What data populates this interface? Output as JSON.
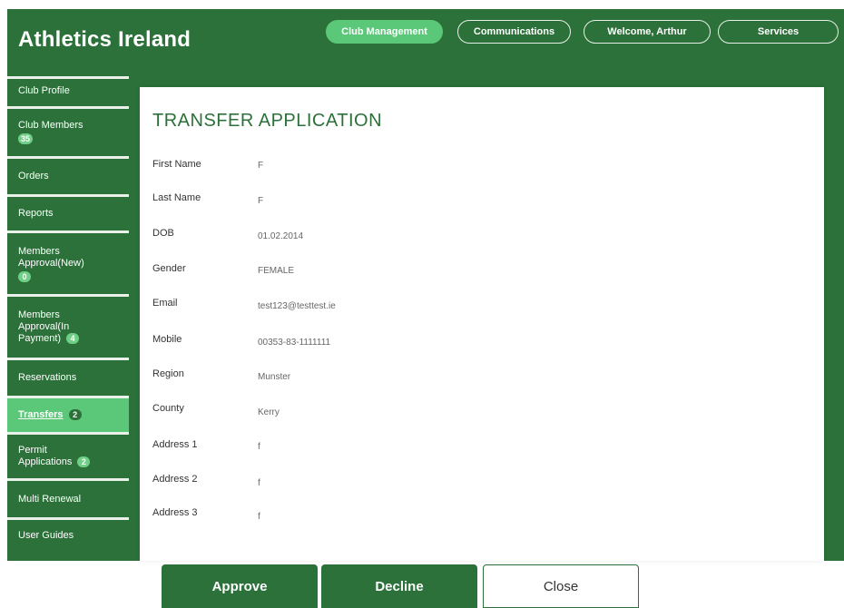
{
  "header": {
    "brand": "Athletics Ireland",
    "nav": [
      {
        "label": "Club Management",
        "active": true
      },
      {
        "label": "Communications",
        "active": false
      },
      {
        "label": "Welcome, Arthur",
        "active": false
      },
      {
        "label": "Services",
        "active": false
      }
    ]
  },
  "sidebar": {
    "items": [
      {
        "label": "Club Profile"
      },
      {
        "label": "Club Members",
        "badge": "35"
      },
      {
        "label": "Orders"
      },
      {
        "label": "Reports"
      },
      {
        "label_lines": [
          "Members",
          "Approval(New)"
        ],
        "badge": "0"
      },
      {
        "label_lines": [
          "Members",
          "Approval(In",
          "Payment)"
        ],
        "badge": "4"
      },
      {
        "label": "Reservations"
      },
      {
        "label": "Transfers",
        "badge": "2",
        "active": true
      },
      {
        "label_lines": [
          "Permit",
          "Applications"
        ],
        "badge": "2"
      },
      {
        "label": "Multi Renewal"
      },
      {
        "label": "User Guides"
      }
    ]
  },
  "form": {
    "title": "TRANSFER APPLICATION",
    "fields": [
      {
        "label": "First Name",
        "value": "F"
      },
      {
        "label": "Last Name",
        "value": "F"
      },
      {
        "label": "DOB",
        "value": "01.02.2014"
      },
      {
        "label": "Gender",
        "value": "FEMALE"
      },
      {
        "label": "Email",
        "value": "test123@testtest.ie"
      },
      {
        "label": "Mobile",
        "value": "00353-83-1111111"
      },
      {
        "label": "Region",
        "value": "Munster"
      },
      {
        "label": "County",
        "value": "Kerry"
      },
      {
        "label": "Address 1",
        "value": "f"
      },
      {
        "label": "Address 2",
        "value": "f"
      },
      {
        "label": "Address 3",
        "value": "f"
      }
    ]
  },
  "actions": {
    "approve": "Approve",
    "decline": "Decline",
    "close": "Close"
  },
  "colors": {
    "brand_green": "#2b7139",
    "accent_green": "#5bc778"
  }
}
